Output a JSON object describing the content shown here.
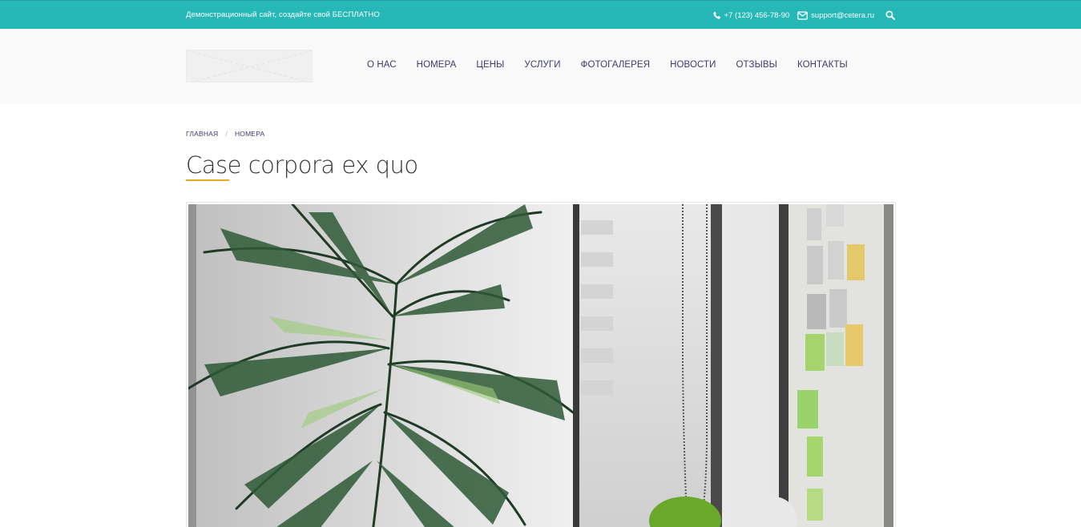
{
  "topbar": {
    "promo": "Демонстрационный сайт, создайте свой БЕСПЛАТНО",
    "phone": "+7 (123) 456-78-90",
    "email": "support@cetera.ru",
    "bg_color": "#26b8b6"
  },
  "nav": {
    "items": [
      "О НАС",
      "НОМЕРА",
      "ЦЕНЫ",
      "УСЛУГИ",
      "ФОТОГАЛЕРЕЯ",
      "НОВОСТИ",
      "ОТЗЫВЫ",
      "КОНТАКТЫ"
    ]
  },
  "breadcrumb": {
    "home": "ГЛАВНАЯ",
    "current": "НОМЕРА",
    "separator": "/"
  },
  "page": {
    "title": "Case corpora ex quo",
    "accent_color": "#e8a92b"
  },
  "icons": {
    "phone": "phone-icon",
    "email": "envelope-icon",
    "search": "search-icon"
  }
}
